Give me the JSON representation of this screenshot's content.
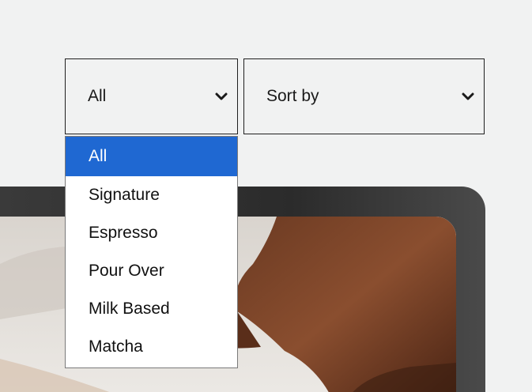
{
  "filters": {
    "category": {
      "selected": "All",
      "options": [
        "All",
        "Signature",
        "Espresso",
        "Pour Over",
        "Milk Based",
        "Matcha"
      ],
      "highlighted_index": 0
    },
    "sort": {
      "selected": "Sort by"
    }
  },
  "icons": {
    "chevron": "chevron-down-icon"
  },
  "colors": {
    "background": "#f1f2f2",
    "highlight": "#1f68d2",
    "border": "#1f1f1f"
  }
}
